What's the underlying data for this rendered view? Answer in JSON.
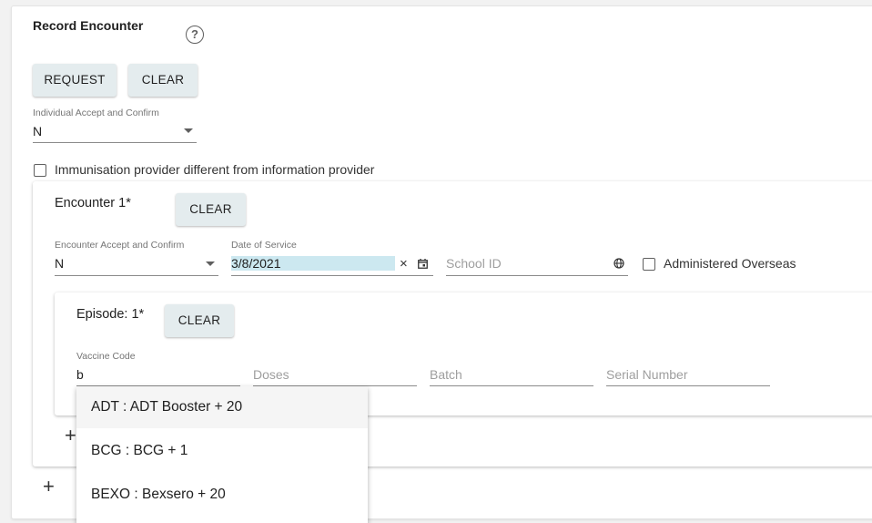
{
  "header": {
    "title": "Record Encounter",
    "help_icon": "?"
  },
  "toolbar": {
    "request_label": "REQUEST",
    "clear_label": "CLEAR"
  },
  "individual_accept": {
    "label": "Individual Accept and Confirm",
    "value": "N"
  },
  "provider_checkbox": {
    "label": "Immunisation provider different from information provider",
    "checked": false
  },
  "encounter": {
    "title": "Encounter 1*",
    "clear_label": "CLEAR",
    "accept_label": "Encounter Accept and Confirm",
    "accept_value": "N",
    "date_label": "Date of Service",
    "date_value": "3/8/2021",
    "clear_date_icon": "×",
    "calendar_icon": "calendar-icon",
    "school_placeholder": "School ID",
    "globe_icon": "globe-icon",
    "overseas_label": "Administered Overseas",
    "overseas_checked": false
  },
  "episode": {
    "title": "Episode: 1*",
    "clear_label": "CLEAR",
    "vaccine_label": "Vaccine Code",
    "vaccine_value": "b",
    "doses_placeholder": "Doses",
    "batch_placeholder": "Batch",
    "serial_placeholder": "Serial Number"
  },
  "add_episode_icon": "+",
  "add_encounter_icon": "+",
  "vaccine_options": [
    "ADT : ADT Booster + 20",
    "BCG : BCG + 1",
    "BEXO : Bexsero + 20"
  ],
  "colors": {
    "button_bg": "#e4ecee",
    "date_highlight": "#cce8f0",
    "option_hover": "#f5f5f5"
  }
}
